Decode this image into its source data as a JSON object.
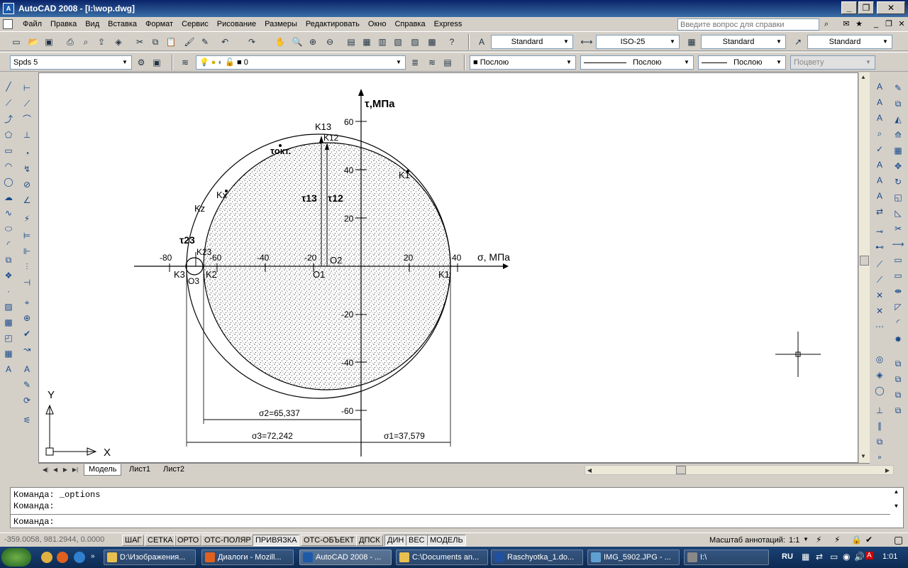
{
  "window": {
    "title": "AutoCAD 2008 - [I:\\wop.dwg]",
    "app_icon": "A",
    "minimize": "_",
    "restore": "❐",
    "close": "✕",
    "doc_minimize": "_",
    "doc_restore": "❐",
    "doc_close": "✕"
  },
  "menu": {
    "items": [
      "Файл",
      "Правка",
      "Вид",
      "Вставка",
      "Формат",
      "Сервис",
      "Рисование",
      "Размеры",
      "Редактировать",
      "Окно",
      "Справка",
      "Express"
    ],
    "help_search_placeholder": "Введите вопрос для справки"
  },
  "toolbar_styles": {
    "text_style": "Standard",
    "dim_style": "ISO-25",
    "table_style": "Standard",
    "mleader_style": "Standard"
  },
  "toolbar_layers": {
    "workspace": "Spds 5",
    "layer": "0",
    "color": "Послою",
    "linetype": "Послою",
    "lineweight": "Послою",
    "plotstyle": "Поцвету"
  },
  "drawing": {
    "sigma_axis_label": "σ, МПа",
    "tau_axis_label": "τ,МПа",
    "x_ticks": [
      "-80",
      "-60",
      "-40",
      "-20",
      "20",
      "40"
    ],
    "y_ticks": [
      "60",
      "40",
      "20",
      "-20",
      "-40",
      "-60"
    ],
    "labels": {
      "K13": "K13",
      "K12": "K12",
      "tau_oct": "τокт.",
      "K1_top": "K1",
      "Kx": "Kx",
      "Kz": "Kz",
      "tau13": "τ13",
      "tau12": "τ12",
      "tau23": "τ23",
      "K23": "K23",
      "K3": "K3",
      "K2": "K2",
      "O3": "O3",
      "O1": "O1",
      "O2": "O2",
      "K1": "K1"
    },
    "dims": {
      "sigma2": "σ2=65,337",
      "sigma3": "σ3=72,242",
      "sigma1": "σ1=37,579"
    },
    "ucs_x": "X",
    "ucs_y": "Y"
  },
  "layout_tabs": [
    "Модель",
    "Лист1",
    "Лист2"
  ],
  "command": {
    "line1": "Команда:  _options",
    "line2": "Команда:",
    "prompt": "Команда:"
  },
  "status": {
    "coords": "-359.0058, 981.2944, 0.0000",
    "toggles": [
      "ШАГ",
      "СЕТКА",
      "ОРТО",
      "ОТС-ПОЛЯР",
      "ПРИВЯЗКА",
      "ОТС-ОБЪЕКТ",
      "ДПСК",
      "ДИН",
      "ВЕС",
      "МОДЕЛЬ"
    ],
    "scale_label": "Масштаб аннотаций:",
    "scale_value": "1:1"
  },
  "taskbar": {
    "tasks": [
      "D:\\Изображения...",
      "Диалоги - Mozill...",
      "AutoCAD 2008 - ...",
      "C:\\Documents an...",
      "Raschyotka_1.do...",
      "IMG_5902.JPG - ...",
      "I:\\"
    ],
    "lang": "RU",
    "clock": "1:01"
  }
}
